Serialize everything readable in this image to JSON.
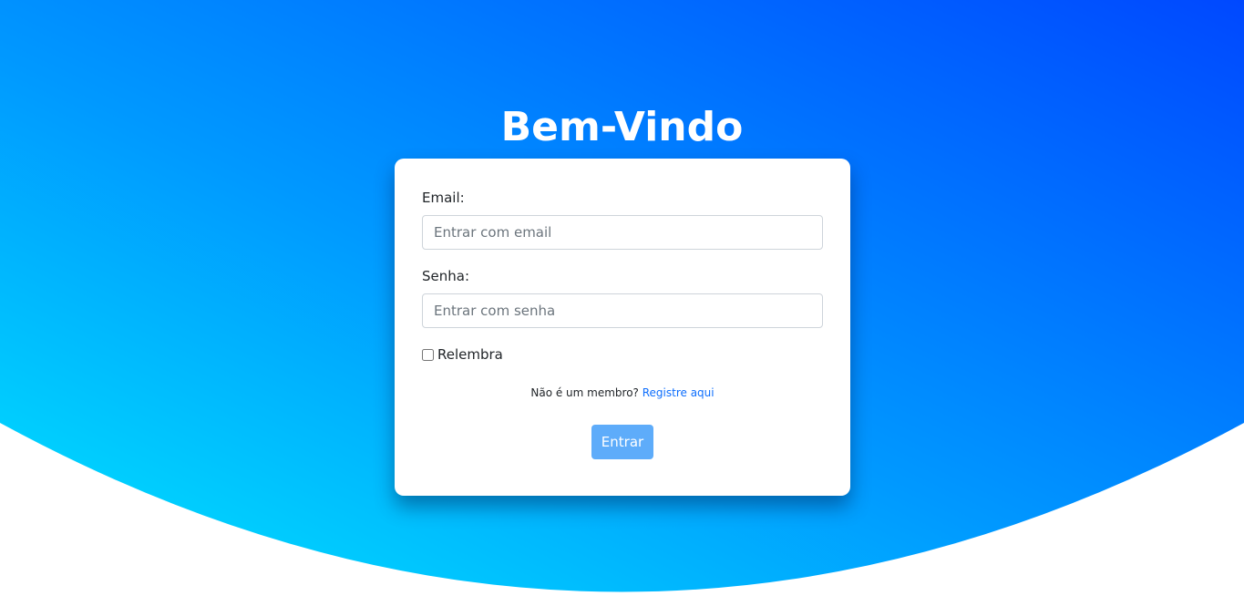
{
  "header": {
    "title": "Bem-Vindo"
  },
  "form": {
    "email_label": "Email:",
    "email_placeholder": "Entrar com email",
    "email_value": "",
    "password_label": "Senha:",
    "password_placeholder": "Entrar com senha",
    "password_value": "",
    "remember_label": "Relembra",
    "remember_checked": false,
    "not_member_text": "Não é um membro?",
    "register_link": "Registre aqui",
    "submit_label": "Entrar"
  },
  "colors": {
    "gradient_light": "#00dcfc",
    "gradient_dark": "#0050ff",
    "button": "#5eacfa",
    "link": "#0d6efd"
  }
}
